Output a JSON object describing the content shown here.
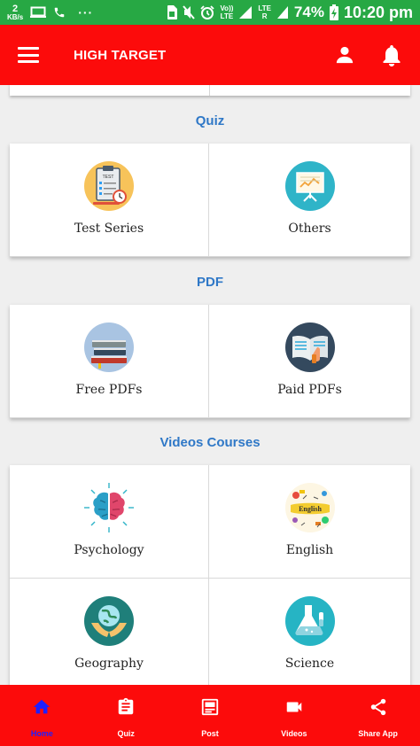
{
  "status_bar": {
    "kbs_value": "2",
    "kbs_unit": "KB/s",
    "dots": "···",
    "volte_top": "Vo))",
    "volte_bottom": "LTE",
    "lte_top": "LTE",
    "lte_bottom": "R",
    "battery": "74%",
    "time": "10:20 pm"
  },
  "app_bar": {
    "title": "HIGH TARGET"
  },
  "sections": [
    {
      "title": "Quiz",
      "items": [
        {
          "label": "Test Series",
          "icon": "test-series-icon"
        },
        {
          "label": "Others",
          "icon": "presentation-board-icon"
        }
      ]
    },
    {
      "title": "PDF",
      "items": [
        {
          "label": "Free PDFs",
          "icon": "books-icon"
        },
        {
          "label": "Paid PDFs",
          "icon": "open-book-icon"
        }
      ]
    },
    {
      "title": "Videos Courses",
      "items": [
        {
          "label": "Psychology",
          "icon": "brain-icon"
        },
        {
          "label": "English",
          "icon": "english-doodle-icon"
        },
        {
          "label": "Geography",
          "icon": "globe-hands-icon"
        },
        {
          "label": "Science",
          "icon": "flask-icon"
        }
      ]
    }
  ],
  "bottom_nav": [
    {
      "label": "Home",
      "icon": "home-icon",
      "active": true
    },
    {
      "label": "Quiz",
      "icon": "clipboard-icon",
      "active": false
    },
    {
      "label": "Post",
      "icon": "post-icon",
      "active": false
    },
    {
      "label": "Videos",
      "icon": "video-camera-icon",
      "active": false
    },
    {
      "label": "Share App",
      "icon": "share-icon",
      "active": false
    }
  ],
  "colors": {
    "status_bar": "#27a844",
    "primary": "#fc0b0b",
    "section_title": "#2f78c7",
    "active_nav": "#1f1fff",
    "background": "#efefef"
  }
}
